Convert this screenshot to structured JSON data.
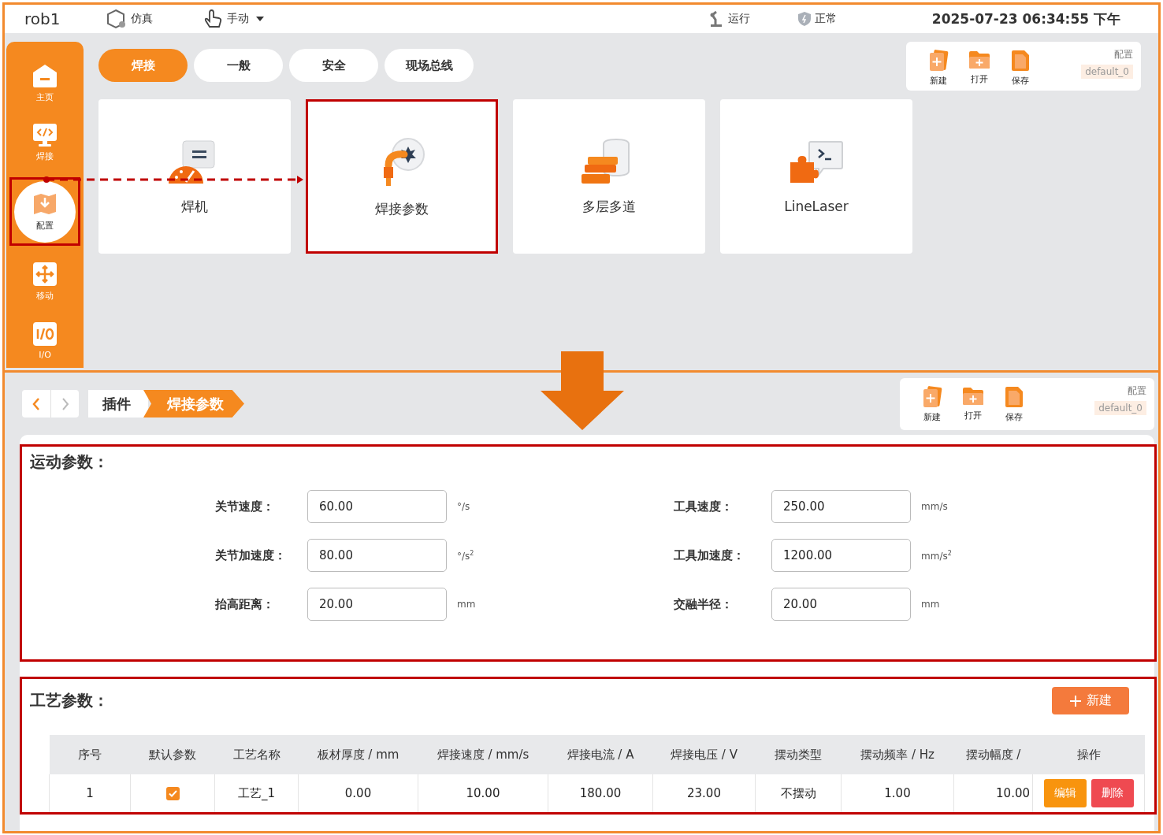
{
  "top_screen": {
    "header": {
      "robot": "rob1",
      "mode": {
        "label": "仿真"
      },
      "control": {
        "label": "手动"
      },
      "run_state": {
        "label": "运行"
      },
      "safety_state": {
        "label": "正常"
      },
      "datetime": "2025-07-23 06:34:55 下午"
    },
    "sidebar": {
      "items": [
        {
          "label": "主页",
          "kind": "home",
          "selected": false,
          "highlighted": false
        },
        {
          "label": "焊接",
          "kind": "code",
          "selected": false,
          "highlighted": false
        },
        {
          "label": "配置",
          "kind": "config",
          "selected": true,
          "highlighted": true
        },
        {
          "label": "移动",
          "kind": "move",
          "selected": false,
          "highlighted": false
        },
        {
          "label": "I/O",
          "kind": "io",
          "selected": false,
          "highlighted": false
        }
      ]
    },
    "tabs": [
      {
        "label": "焊接",
        "selected": true
      },
      {
        "label": "一般",
        "selected": false
      },
      {
        "label": "安全",
        "selected": false
      },
      {
        "label": "现场总线",
        "selected": false
      }
    ],
    "cards": [
      {
        "label": "焊机",
        "kind": "welder",
        "highlighted": false
      },
      {
        "label": "焊接参数",
        "kind": "torch",
        "highlighted": true
      },
      {
        "label": "多层多道",
        "kind": "layers",
        "highlighted": false
      },
      {
        "label": "LineLaser",
        "kind": "plugin",
        "highlighted": false
      }
    ],
    "toolbar": {
      "buttons": [
        {
          "label": "新建",
          "kind": "new"
        },
        {
          "label": "打开",
          "kind": "open"
        },
        {
          "label": "保存",
          "kind": "save"
        }
      ],
      "config_label": "配置",
      "config_value": "default_0"
    }
  },
  "bottom_screen": {
    "nav": {
      "back_disabled": false,
      "forward_disabled": true
    },
    "breadcrumb": [
      {
        "label": "插件",
        "selected": false
      },
      {
        "label": "焊接参数",
        "selected": true
      }
    ],
    "toolbar": {
      "buttons": [
        {
          "label": "新建",
          "kind": "new"
        },
        {
          "label": "打开",
          "kind": "open"
        },
        {
          "label": "保存",
          "kind": "save"
        }
      ],
      "config_label": "配置",
      "config_value": "default_0"
    },
    "motion": {
      "title": "运动参数：",
      "highlighted": true,
      "fields": [
        {
          "label": "关节速度：",
          "value": "60.00",
          "unit": "°/s"
        },
        {
          "label": "工具速度：",
          "value": "250.00",
          "unit": "mm/s"
        },
        {
          "label": "关节加速度：",
          "value": "80.00",
          "unit": "°/s$^{2}$"
        },
        {
          "label": "工具加速度：",
          "value": "1200.00",
          "unit": "mm/s$^{2}$"
        },
        {
          "label": "抬高距离：",
          "value": "20.00",
          "unit": "mm"
        },
        {
          "label": "交融半径：",
          "value": "20.00",
          "unit": "mm"
        }
      ]
    },
    "process": {
      "title": "工艺参数：",
      "highlighted": true,
      "new_button": "新建",
      "table": {
        "columns": [
          "序号",
          "默认参数",
          "工艺名称",
          "板材厚度 / mm",
          "焊接速度 / mm/s",
          "焊接电流 / A",
          "焊接电压 / V",
          "摆动类型",
          "摆动频率 / Hz",
          "摆动幅度 /",
          "操作"
        ],
        "rows": [
          {
            "index": "1",
            "default": true,
            "values": [
              "工艺_1",
              "0.00",
              "10.00",
              "180.00",
              "23.00",
              "不摆动",
              "1.00",
              "10.00"
            ],
            "actions": [
              {
                "label": "编辑",
                "kind": "edit"
              },
              {
                "label": "删除",
                "kind": "delete"
              }
            ]
          }
        ]
      }
    }
  }
}
